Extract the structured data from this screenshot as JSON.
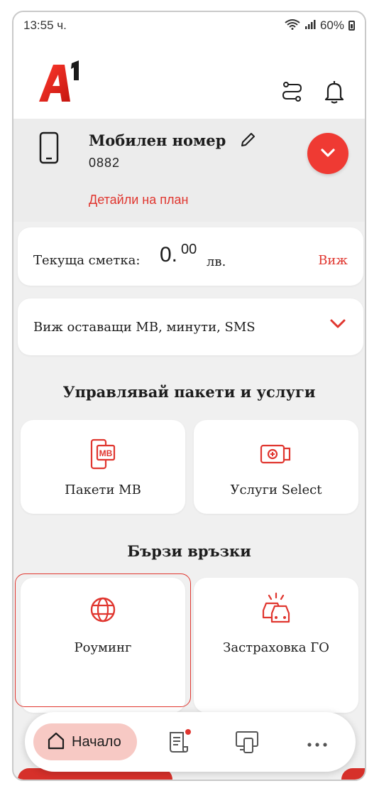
{
  "status_bar": {
    "time": "13:55 ч.",
    "battery": "60%",
    "icons": [
      "wifi-icon",
      "signal-icon",
      "battery-icon"
    ]
  },
  "header": {
    "logo": "A1",
    "icons": [
      "route-icon",
      "bell-icon"
    ]
  },
  "account": {
    "title": "Мобилен номер",
    "number": "0882",
    "plan_link": "Детайли на план"
  },
  "bill": {
    "label": "Текуща сметка:",
    "amount": "0.",
    "cents": "00",
    "currency": "лв.",
    "link": "Виж"
  },
  "remaining": {
    "label": "Виж оставащи МВ, минути, SMS"
  },
  "manage": {
    "title": "Управлявай пакети и услуги",
    "tiles": [
      {
        "label": "Пакети МВ",
        "icon": "mb-phone-icon",
        "icon_text": "MB"
      },
      {
        "label": "Услуги Select",
        "icon": "select-services-icon"
      }
    ]
  },
  "quick_links": {
    "title": "Бързи връзки",
    "tiles": [
      {
        "label": "Роуминг",
        "icon": "globe-icon"
      },
      {
        "label": "Застраховка ГО",
        "icon": "car-crash-icon"
      }
    ]
  },
  "nav": {
    "items": [
      {
        "label": "Начало",
        "icon": "home-icon",
        "active": true
      },
      {
        "label": "",
        "icon": "bills-icon"
      },
      {
        "label": "",
        "icon": "devices-icon"
      },
      {
        "label": "",
        "icon": "more-icon"
      }
    ]
  },
  "colors": {
    "accent": "#e0362f",
    "accent_button": "#ef3a33",
    "home_pill": "#f7c9c4",
    "background": "#f0f0f0"
  }
}
